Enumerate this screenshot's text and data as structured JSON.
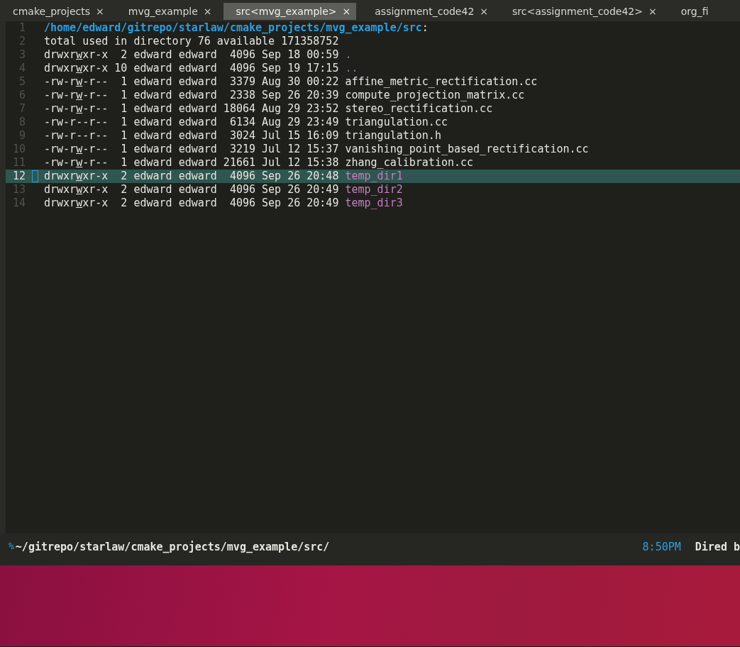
{
  "tabs": [
    {
      "label": "cmake_projects",
      "close": "×",
      "selected": false
    },
    {
      "label": "mvg_example",
      "close": "×",
      "selected": false
    },
    {
      "label": "src<mvg_example>",
      "close": "×",
      "selected": true
    },
    {
      "label": "assignment_code42",
      "close": "×",
      "selected": false
    },
    {
      "label": "src<assignment_code42>",
      "close": "×",
      "selected": false
    },
    {
      "label": "org_fi",
      "selected": false
    }
  ],
  "header": {
    "number": "1",
    "path": "/home/edward/gitrepo/starlaw/cmake_projects/mvg_example/src",
    "colon": ":"
  },
  "summary": {
    "number": "2",
    "text": "total used in directory 76 available 171358752"
  },
  "rows": [
    {
      "number": "3",
      "perm_head": "drwxr",
      "perm_mark": "w",
      "perm_tail": "xr-x",
      "info": "  2 edward edward  4096 Sep 18 00:59",
      "name": ".",
      "kind": "special",
      "selected": false
    },
    {
      "number": "4",
      "perm_head": "drwxr",
      "perm_mark": "w",
      "perm_tail": "xr-x",
      "info": " 10 edward edward  4096 Sep 19 17:15",
      "name": "..",
      "kind": "special",
      "selected": false
    },
    {
      "number": "5",
      "perm_head": "-rw-r",
      "perm_mark": "w",
      "perm_tail": "-r--",
      "info": "  1 edward edward  3379 Aug 30 00:22",
      "name": "affine_metric_rectification.cc",
      "kind": "file",
      "selected": false
    },
    {
      "number": "6",
      "perm_head": "-rw-r",
      "perm_mark": "w",
      "perm_tail": "-r--",
      "info": "  1 edward edward  2338 Sep 26 20:39",
      "name": "compute_projection_matrix.cc",
      "kind": "file",
      "selected": false
    },
    {
      "number": "7",
      "perm_head": "-rw-r",
      "perm_mark": "w",
      "perm_tail": "-r--",
      "info": "  1 edward edward 18064 Aug 29 23:52",
      "name": "stereo_rectification.cc",
      "kind": "file",
      "selected": false
    },
    {
      "number": "8",
      "perm_head": "-rw-r--r--",
      "info": "  1 edward edward  6134 Aug 29 23:49",
      "name": "triangulation.cc",
      "kind": "file",
      "selected": false
    },
    {
      "number": "9",
      "perm_head": "-rw-r--r--",
      "info": "  1 edward edward  3024 Jul 15 16:09",
      "name": "triangulation.h",
      "kind": "file",
      "selected": false
    },
    {
      "number": "10",
      "perm_head": "-rw-r",
      "perm_mark": "w",
      "perm_tail": "-r--",
      "info": "  1 edward edward  3219 Jul 12 15:37",
      "name": "vanishing_point_based_rectification.cc",
      "kind": "file",
      "selected": false
    },
    {
      "number": "11",
      "perm_head": "-rw-r",
      "perm_mark": "w",
      "perm_tail": "-r--",
      "info": "  1 edward edward 21661 Jul 12 15:38",
      "name": "zhang_calibration.cc",
      "kind": "file",
      "selected": false
    },
    {
      "number": "12",
      "perm_head": "drwxr",
      "perm_mark": "w",
      "perm_tail": "xr-x",
      "info": "  2 edward edward  4096 Sep 26 20:48",
      "name": "temp_dir1",
      "kind": "dir",
      "selected": true
    },
    {
      "number": "13",
      "perm_head": "drwxr",
      "perm_mark": "w",
      "perm_tail": "xr-x",
      "info": "  2 edward edward  4096 Sep 26 20:49",
      "name": "temp_dir2",
      "kind": "dir",
      "selected": false
    },
    {
      "number": "14",
      "perm_head": "drwxr",
      "perm_mark": "w",
      "perm_tail": "xr-x",
      "info": "  2 edward edward  4096 Sep 26 20:49",
      "name": "temp_dir3",
      "kind": "dir",
      "selected": false
    }
  ],
  "status_bar": {
    "indicator": "%",
    "path": "~/gitrepo/starlaw/cmake_projects/mvg_example/src/",
    "time": "8:50PM",
    "mode": "Dired b"
  }
}
